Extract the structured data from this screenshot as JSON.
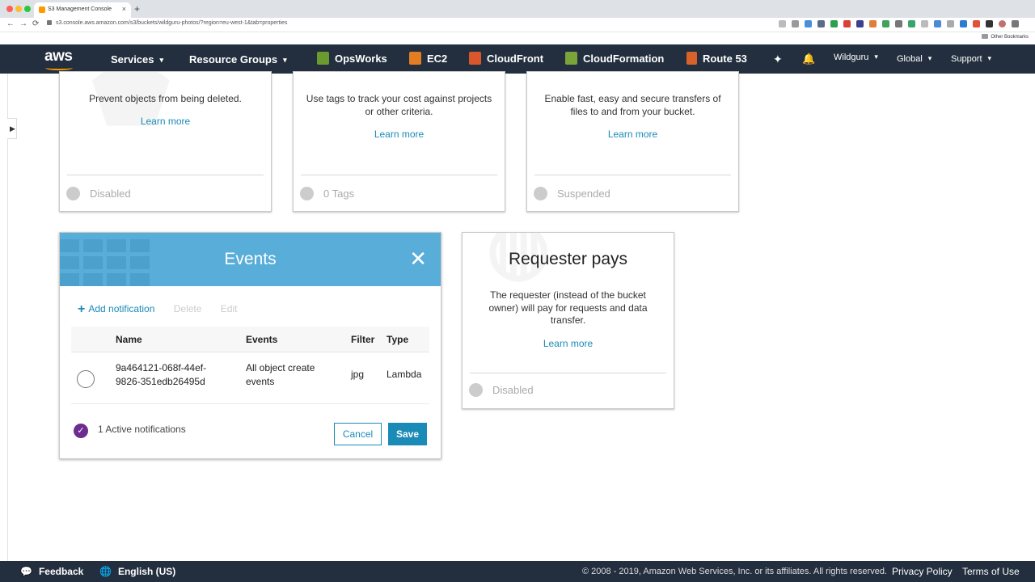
{
  "browser": {
    "tab_title": "S3 Management Console",
    "url": "s3.console.aws.amazon.com/s3/buckets/wildguru-photos/?region=eu-west-1&tab=properties",
    "bookmarks_label": "Other Bookmarks",
    "back_icon": "←",
    "forward_icon": "→",
    "reload_icon": "⟳",
    "new_tab_icon": "+",
    "tab_close_icon": "×"
  },
  "awsnav": {
    "logo": "aws",
    "services": "Services",
    "resource_groups": "Resource Groups",
    "opsworks": "OpsWorks",
    "ec2": "EC2",
    "cloudfront": "CloudFront",
    "cloudformation": "CloudFormation",
    "route53": "Route 53",
    "user": "Wildguru",
    "region": "Global",
    "support": "Support",
    "caret": "▾",
    "pin_icon": "✦",
    "bell_icon": "🔔"
  },
  "cards_top": [
    {
      "description": "Prevent objects from being deleted.",
      "learn_more": "Learn more",
      "status": "Disabled"
    },
    {
      "description": "Use tags to track your cost against projects or other criteria.",
      "learn_more": "Learn more",
      "status": "0 Tags"
    },
    {
      "description": "Enable fast, easy and secure transfers of files to and from your bucket.",
      "learn_more": "Learn more",
      "status": "Suspended"
    }
  ],
  "events": {
    "title": "Events",
    "close_icon": "✕",
    "add_notification": "Add notification",
    "add_icon": "+",
    "delete": "Delete",
    "edit": "Edit",
    "columns": [
      "Name",
      "Events",
      "Filter",
      "Type"
    ],
    "rows": [
      {
        "name_line1": "9a464121-068f-44ef-",
        "name_line2": "9826-351edb26495d",
        "events_line1": "All object create",
        "events_line2": "events",
        "filter": "jpg",
        "type": "Lambda"
      }
    ],
    "active_text": "1 Active notifications",
    "check_icon": "✓",
    "cancel": "Cancel",
    "save": "Save"
  },
  "requester_pays": {
    "title": "Requester pays",
    "description": "The requester (instead of the bucket owner) will pay for requests and data transfer.",
    "learn_more": "Learn more",
    "status": "Disabled"
  },
  "footer": {
    "feedback": "Feedback",
    "language": "English (US)",
    "copyright": "© 2008 - 2019, Amazon Web Services, Inc. or its affiliates. All rights reserved.",
    "privacy": "Privacy Policy",
    "terms": "Terms of Use",
    "feedback_icon": "💬",
    "globe_icon": "🌐"
  },
  "colors": {
    "nav_bg": "#232f3e",
    "accent": "#1a8bb7",
    "events_header": "#59add9",
    "active_check": "#6b2d8f"
  }
}
